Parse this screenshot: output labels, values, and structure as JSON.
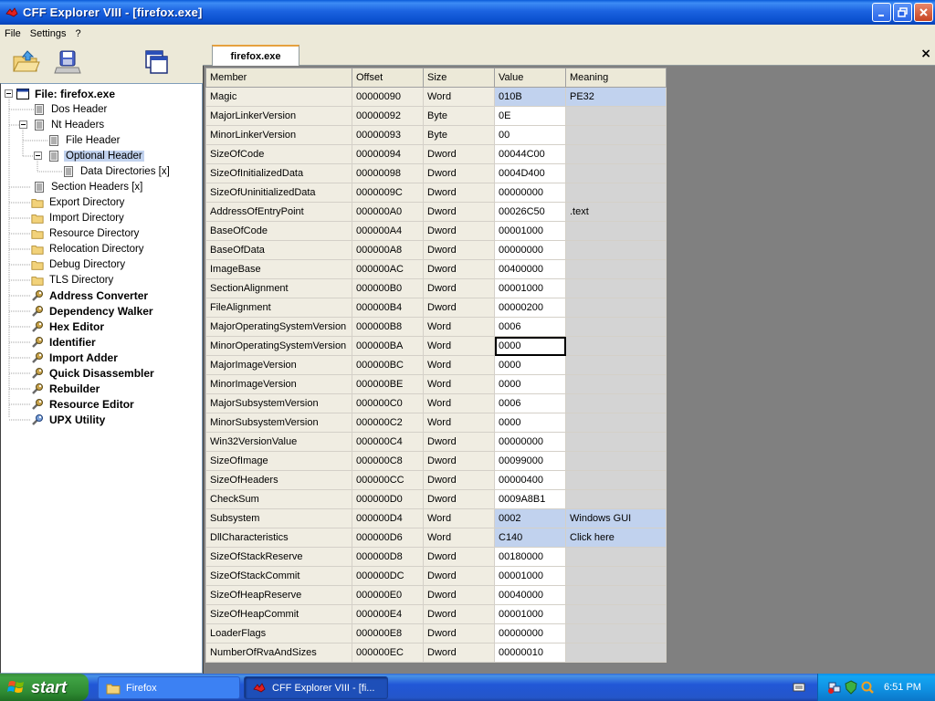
{
  "window": {
    "title": "CFF Explorer VIII - [firefox.exe]"
  },
  "menu": [
    "File",
    "Settings",
    "?"
  ],
  "toolbar": {
    "buttons": [
      "open-folder-icon",
      "save-disk-icon",
      "windows-icon"
    ]
  },
  "tree": {
    "root": "File: firefox.exe",
    "items": [
      {
        "label": "Dos Header",
        "icon": "page-icon"
      },
      {
        "label": "Nt Headers",
        "icon": "page-icon"
      },
      {
        "label": "File Header",
        "icon": "page-icon"
      },
      {
        "label": "Optional Header",
        "icon": "page-icon",
        "selected": true
      },
      {
        "label": "Data Directories [x]",
        "icon": "page-icon"
      },
      {
        "label": "Section Headers [x]",
        "icon": "page-icon"
      },
      {
        "label": "Export Directory",
        "icon": "folder-icon"
      },
      {
        "label": "Import Directory",
        "icon": "folder-icon"
      },
      {
        "label": "Resource Directory",
        "icon": "folder-icon"
      },
      {
        "label": "Relocation Directory",
        "icon": "folder-icon"
      },
      {
        "label": "Debug Directory",
        "icon": "folder-icon"
      },
      {
        "label": "TLS Directory",
        "icon": "folder-icon"
      },
      {
        "label": "Address Converter",
        "icon": "tool-icon"
      },
      {
        "label": "Dependency Walker",
        "icon": "tool-icon"
      },
      {
        "label": "Hex Editor",
        "icon": "tool-icon"
      },
      {
        "label": "Identifier",
        "icon": "tool-icon"
      },
      {
        "label": "Import Adder",
        "icon": "tool-icon"
      },
      {
        "label": "Quick Disassembler",
        "icon": "tool-icon"
      },
      {
        "label": "Rebuilder",
        "icon": "tool-icon"
      },
      {
        "label": "Resource Editor",
        "icon": "tool-icon"
      },
      {
        "label": "UPX Utility",
        "icon": "tool-icon"
      }
    ]
  },
  "tab": {
    "label": "firefox.exe",
    "close": "×"
  },
  "grid": {
    "headers": [
      "Member",
      "Offset",
      "Size",
      "Value",
      "Meaning"
    ],
    "rows": [
      [
        "Magic",
        "00000090",
        "Word",
        "010B",
        "PE32"
      ],
      [
        "MajorLinkerVersion",
        "00000092",
        "Byte",
        "0E",
        ""
      ],
      [
        "MinorLinkerVersion",
        "00000093",
        "Byte",
        "00",
        ""
      ],
      [
        "SizeOfCode",
        "00000094",
        "Dword",
        "00044C00",
        ""
      ],
      [
        "SizeOfInitializedData",
        "00000098",
        "Dword",
        "0004D400",
        ""
      ],
      [
        "SizeOfUninitializedData",
        "0000009C",
        "Dword",
        "00000000",
        ""
      ],
      [
        "AddressOfEntryPoint",
        "000000A0",
        "Dword",
        "00026C50",
        ".text"
      ],
      [
        "BaseOfCode",
        "000000A4",
        "Dword",
        "00001000",
        ""
      ],
      [
        "BaseOfData",
        "000000A8",
        "Dword",
        "00000000",
        ""
      ],
      [
        "ImageBase",
        "000000AC",
        "Dword",
        "00400000",
        ""
      ],
      [
        "SectionAlignment",
        "000000B0",
        "Dword",
        "00001000",
        ""
      ],
      [
        "FileAlignment",
        "000000B4",
        "Dword",
        "00000200",
        ""
      ],
      [
        "MajorOperatingSystemVersion",
        "000000B8",
        "Word",
        "0006",
        ""
      ],
      [
        "MinorOperatingSystemVersion",
        "000000BA",
        "Word",
        "0000",
        ""
      ],
      [
        "MajorImageVersion",
        "000000BC",
        "Word",
        "0000",
        ""
      ],
      [
        "MinorImageVersion",
        "000000BE",
        "Word",
        "0000",
        ""
      ],
      [
        "MajorSubsystemVersion",
        "000000C0",
        "Word",
        "0006",
        ""
      ],
      [
        "MinorSubsystemVersion",
        "000000C2",
        "Word",
        "0000",
        ""
      ],
      [
        "Win32VersionValue",
        "000000C4",
        "Dword",
        "00000000",
        ""
      ],
      [
        "SizeOfImage",
        "000000C8",
        "Dword",
        "00099000",
        ""
      ],
      [
        "SizeOfHeaders",
        "000000CC",
        "Dword",
        "00000400",
        ""
      ],
      [
        "CheckSum",
        "000000D0",
        "Dword",
        "0009A8B1",
        ""
      ],
      [
        "Subsystem",
        "000000D4",
        "Word",
        "0002",
        "Windows GUI"
      ],
      [
        "DllCharacteristics",
        "000000D6",
        "Word",
        "C140",
        "Click here"
      ],
      [
        "SizeOfStackReserve",
        "000000D8",
        "Dword",
        "00180000",
        ""
      ],
      [
        "SizeOfStackCommit",
        "000000DC",
        "Dword",
        "00001000",
        ""
      ],
      [
        "SizeOfHeapReserve",
        "000000E0",
        "Dword",
        "00040000",
        ""
      ],
      [
        "SizeOfHeapCommit",
        "000000E4",
        "Dword",
        "00001000",
        ""
      ],
      [
        "LoaderFlags",
        "000000E8",
        "Dword",
        "00000000",
        ""
      ],
      [
        "NumberOfRvaAndSizes",
        "000000EC",
        "Dword",
        "00000010",
        ""
      ]
    ],
    "highlighted_rows": [
      0,
      22,
      23
    ],
    "editing_row": 13
  },
  "taskbar": {
    "start_label": "start",
    "tasks": [
      {
        "label": "Firefox",
        "icon": "folder-icon",
        "active": false
      },
      {
        "label": "CFF Explorer VIII - [fi...",
        "icon": "cff-icon",
        "active": true
      }
    ],
    "clock": "6:51 PM"
  },
  "colors": {
    "selection": "#c1d2ee",
    "meaning_bg": "#d4d4d4",
    "grid_bg": "#808080"
  }
}
